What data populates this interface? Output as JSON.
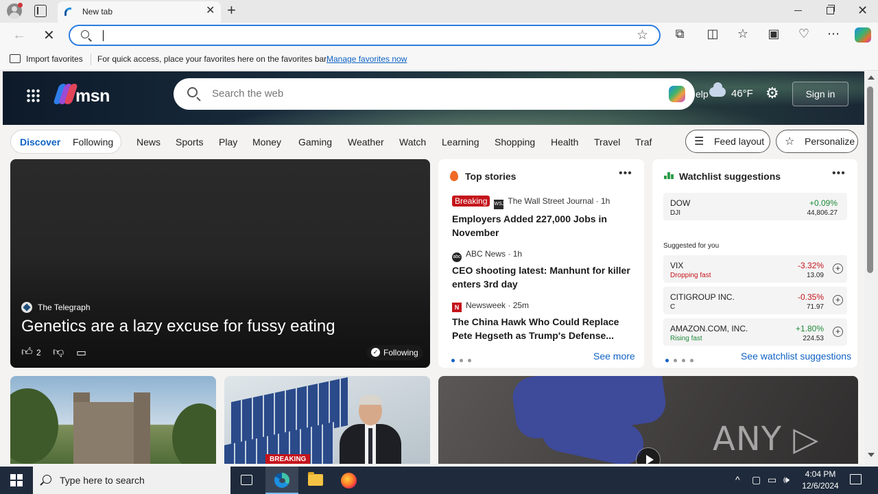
{
  "browser": {
    "tab_title": "New tab",
    "address_value": "",
    "favorites_bar": {
      "import_label": "Import favorites",
      "message": "For quick access, place your favorites here on the favorites bar.",
      "manage_link": "Manage favorites now"
    }
  },
  "msn": {
    "logo_text": "msn",
    "search_placeholder": "Search the web",
    "help_label": "elp",
    "temperature": "46°F",
    "sign_in": "Sign in",
    "nav": {
      "discover": "Discover",
      "following": "Following",
      "items": [
        "News",
        "Sports",
        "Play",
        "Money",
        "Gaming",
        "Weather",
        "Watch",
        "Learning",
        "Shopping",
        "Health",
        "Travel",
        "Traf"
      ],
      "feed_layout": "Feed layout",
      "personalize": "Personalize"
    },
    "main_story": {
      "source": "The Telegraph",
      "title": "Genetics are a lazy excuse for fussy eating",
      "likes": "2",
      "following": "Following"
    },
    "top_stories": {
      "heading": "Top stories",
      "stories": [
        {
          "badge": "Breaking",
          "source": "The Wall Street Journal",
          "age": "1h",
          "title": "Employers Added 227,000 Jobs in November"
        },
        {
          "badge": "",
          "source": "ABC News",
          "age": "1h",
          "title": "CEO shooting latest: Manhunt for killer enters 3rd day"
        },
        {
          "badge": "",
          "source": "Newsweek",
          "age": "25m",
          "title": "The China Hawk Who Could Replace Pete Hegseth as Trump's Defense..."
        }
      ],
      "see_more": "See more"
    },
    "watchlist": {
      "heading": "Watchlist suggestions",
      "index": {
        "name": "DOW",
        "symbol": "DJI",
        "change": "+0.09%",
        "price": "44,806.27"
      },
      "suggested_label": "Suggested for you",
      "stocks": [
        {
          "name": "VIX",
          "sub": "Dropping fast",
          "change": "-3.32%",
          "price": "13.09",
          "direction": "down"
        },
        {
          "name": "CITIGROUP INC.",
          "sub": "C",
          "change": "-0.35%",
          "price": "71.97",
          "direction": "down"
        },
        {
          "name": "AMAZON.COM, INC.",
          "sub": "Rising fast",
          "change": "+1.80%",
          "price": "224.53",
          "direction": "up"
        }
      ],
      "see_suggestions": "See watchlist suggestions"
    },
    "lower_cards": {
      "solar_tag": "BREAKING",
      "watermark": "ANY ▷ RUN"
    }
  },
  "taskbar": {
    "search_placeholder": "Type here to search",
    "time": "4:04 PM",
    "date": "12/6/2024"
  },
  "colors": {
    "accent": "#0f62c4",
    "breaking": "#c4141b",
    "positive": "#1f8a3a",
    "negative": "#c4141b"
  }
}
